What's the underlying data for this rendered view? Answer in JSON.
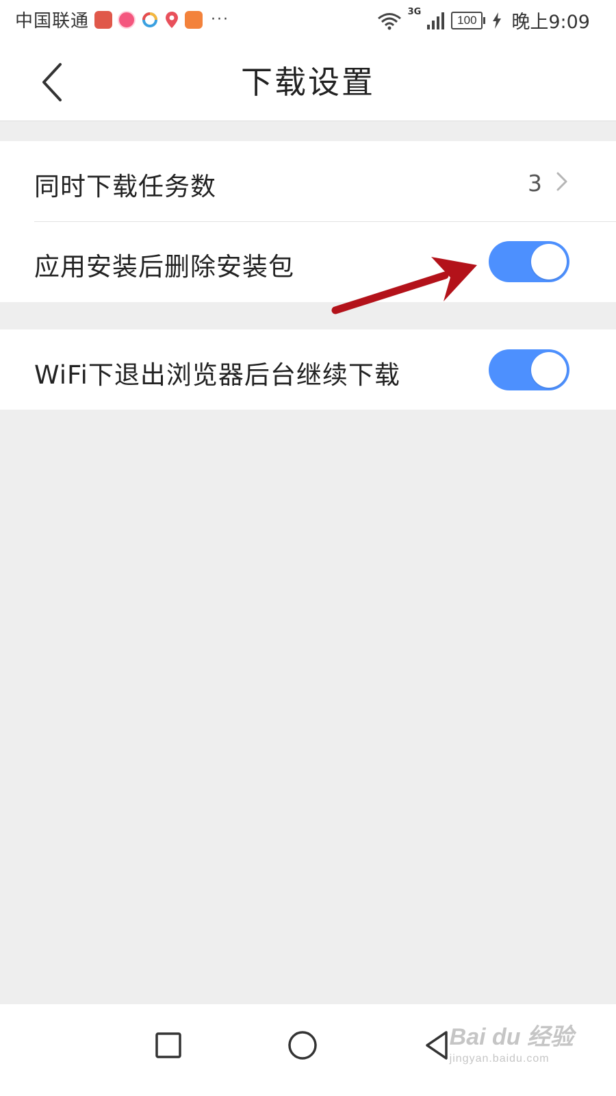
{
  "status_bar": {
    "carrier": "中国联通",
    "overflow": "···",
    "network": "3G",
    "battery": "100",
    "time": "晚上9:09"
  },
  "header": {
    "title": "下载设置"
  },
  "settings": {
    "concurrent_tasks": {
      "label": "同时下载任务数",
      "value": "3"
    },
    "delete_after_install": {
      "label": "应用安装后删除安装包",
      "enabled": true
    },
    "wifi_background": {
      "label": "WiFi下退出浏览器后台继续下载",
      "enabled": true
    }
  },
  "watermark": {
    "main": "Bai du 经验",
    "sub": "jingyan.baidu.com"
  },
  "colors": {
    "toggle_on": "#4d90fe",
    "annotation_arrow": "#b3121a",
    "background": "#eeeeee"
  }
}
